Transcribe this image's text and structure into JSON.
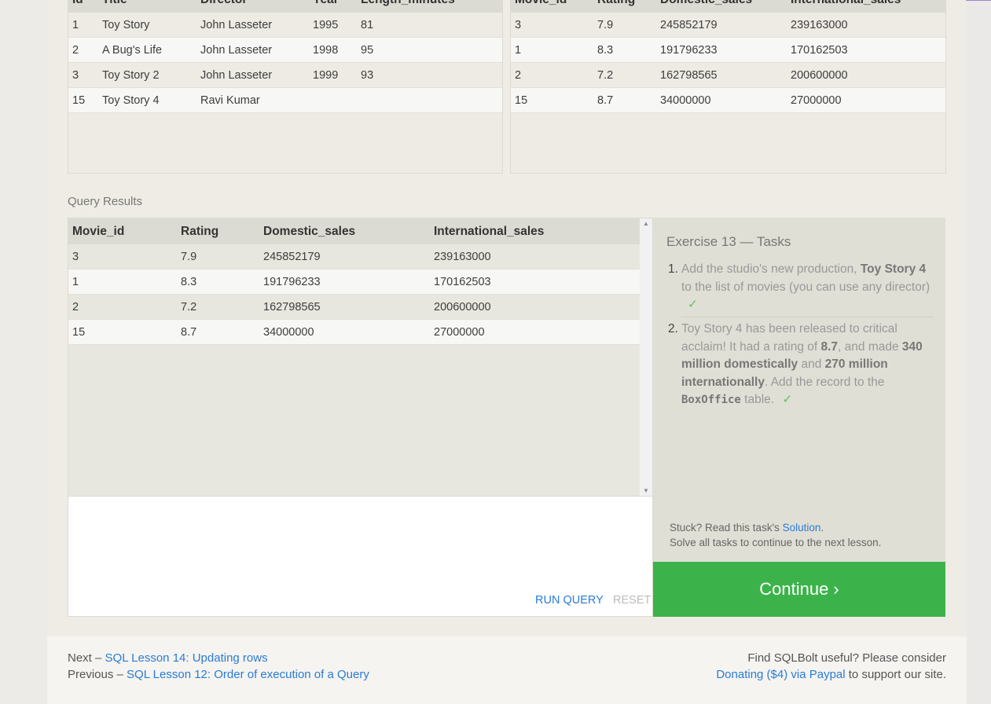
{
  "movies_table": {
    "columns": [
      "Id",
      "Title",
      "Director",
      "Year",
      "Length_minutes"
    ],
    "rows": [
      [
        "1",
        "Toy Story",
        "John Lasseter",
        "1995",
        "81"
      ],
      [
        "2",
        "A Bug's Life",
        "John Lasseter",
        "1998",
        "95"
      ],
      [
        "3",
        "Toy Story 2",
        "John Lasseter",
        "1999",
        "93"
      ],
      [
        "15",
        "Toy Story 4",
        "Ravi Kumar",
        "",
        ""
      ]
    ]
  },
  "boxoffice_table": {
    "columns": [
      "Movie_id",
      "Rating",
      "Domestic_sales",
      "International_sales"
    ],
    "rows": [
      [
        "3",
        "7.9",
        "245852179",
        "239163000"
      ],
      [
        "1",
        "8.3",
        "191796233",
        "170162503"
      ],
      [
        "2",
        "7.2",
        "162798565",
        "200600000"
      ],
      [
        "15",
        "8.7",
        "34000000",
        "27000000"
      ]
    ]
  },
  "query_results": {
    "label": "Query Results",
    "columns": [
      "Movie_id",
      "Rating",
      "Domestic_sales",
      "International_sales"
    ],
    "rows": [
      [
        "3",
        "7.9",
        "245852179",
        "239163000"
      ],
      [
        "1",
        "8.3",
        "191796233",
        "170162503"
      ],
      [
        "2",
        "7.2",
        "162798565",
        "200600000"
      ],
      [
        "15",
        "8.7",
        "34000000",
        "27000000"
      ]
    ]
  },
  "editor": {
    "run_label": "RUN QUERY",
    "reset_label": "RESET"
  },
  "tasks": {
    "title": "Exercise 13 — Tasks",
    "items": [
      {
        "num": "1.",
        "parts": [
          "Add the studio's new production, ",
          "Toy Story 4",
          " to the list of movies (you can use any director)"
        ],
        "check": "✓"
      },
      {
        "num": "2.",
        "parts": [
          "Toy Story 4 has been released to critical acclaim! It had a rating of ",
          "8.7",
          ", and made ",
          "340 million domestically",
          " and ",
          "270 million internationally",
          ". Add the record to the ",
          "BoxOffice",
          " table."
        ],
        "check": "✓"
      }
    ],
    "stuck_prefix": "Stuck? Read this task's ",
    "stuck_link": "Solution",
    "stuck_suffix": ".",
    "solve_note": "Solve all tasks to continue to the next lesson."
  },
  "continue_label": "Continue ›",
  "footer": {
    "next_prefix": "Next – ",
    "next_link": "SQL Lesson 14: Updating rows",
    "prev_prefix": "Previous – ",
    "prev_link": "SQL Lesson 12: Order of execution of a Query",
    "support_line": "Find SQLBolt useful? Please consider",
    "donate_link": "Donating ($4) via Paypal",
    "support_suffix": " to support our site."
  },
  "colors": {
    "accent_link": "#2b7bd6",
    "continue_bg": "#3cb34a",
    "check": "#67c267"
  }
}
